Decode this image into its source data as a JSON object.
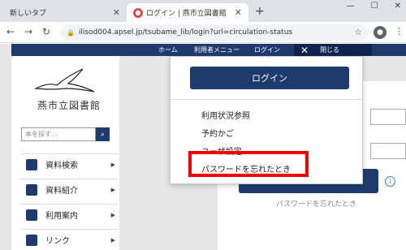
{
  "browser": {
    "tabs": [
      {
        "title": "新しいタブ",
        "active": false
      },
      {
        "title": "ログイン | 燕市立図書館",
        "active": true
      }
    ],
    "url": "ilisod004.apsel.jp/tsubame_lib/login?url=circulation-status"
  },
  "topnav": {
    "home": "ホーム",
    "user_menu": "利用者メニュー",
    "login": "ログイン",
    "close": "閉じる"
  },
  "sidebar": {
    "library_name": "燕市立図書館",
    "search_placeholder": "本を探す…",
    "items": [
      {
        "label": "資料検索"
      },
      {
        "label": "資料紹介"
      },
      {
        "label": "利用案内"
      },
      {
        "label": "リンク"
      }
    ]
  },
  "dropdown": {
    "login_button": "ログイン",
    "items": [
      {
        "label": "利用状況参照"
      },
      {
        "label": "予約かご"
      },
      {
        "label": "ユーザ設定"
      },
      {
        "label": "パスワードを忘れたとき"
      }
    ]
  },
  "main": {
    "forgot_password": "パスワードを忘れたとき"
  },
  "colors": {
    "navy": "#1f3b6e",
    "highlight": "#ee0000"
  }
}
